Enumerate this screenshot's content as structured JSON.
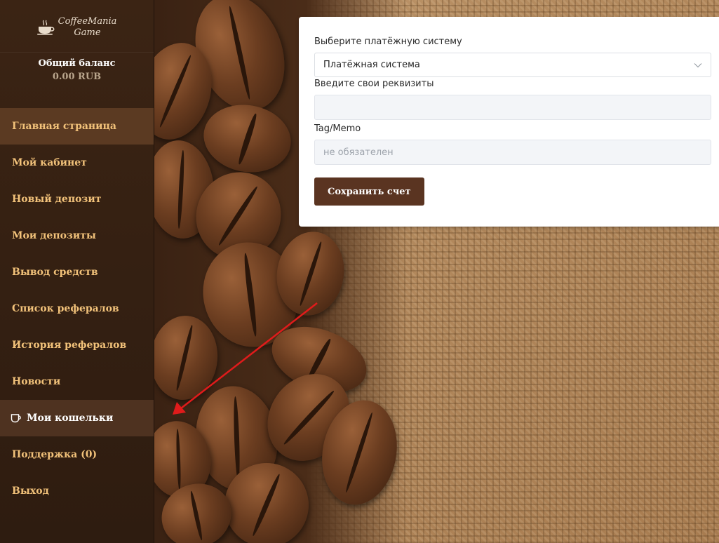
{
  "logo": {
    "line1": "CoffeeMania",
    "line2": "Game"
  },
  "balance": {
    "title": "Общий баланс",
    "value": "0.00 RUB"
  },
  "nav": [
    {
      "label": "Главная страница"
    },
    {
      "label": "Мой кабинет"
    },
    {
      "label": "Новый депозит"
    },
    {
      "label": "Мои депозиты"
    },
    {
      "label": "Вывод средств"
    },
    {
      "label": "Список рефералов"
    },
    {
      "label": "История рефералов"
    },
    {
      "label": "Новости"
    },
    {
      "label": "Мои кошельки",
      "icon": "cup-icon"
    },
    {
      "label": "Поддержка (0)"
    },
    {
      "label": "Выход"
    }
  ],
  "form": {
    "payment_label": "Выберите платёжную систему",
    "payment_selected": "Платёжная система",
    "details_label": "Введите свои реквизиты",
    "details_value": "",
    "memo_label": "Tag/Memo",
    "memo_placeholder": "не обязателен",
    "save_label": "Сохранить счет"
  },
  "colors": {
    "sidebar": "#3b2414",
    "nav_text": "#f2c27a",
    "active_item": "#5b3a22",
    "button": "#5a3421",
    "arrow": "#e01b1b"
  }
}
